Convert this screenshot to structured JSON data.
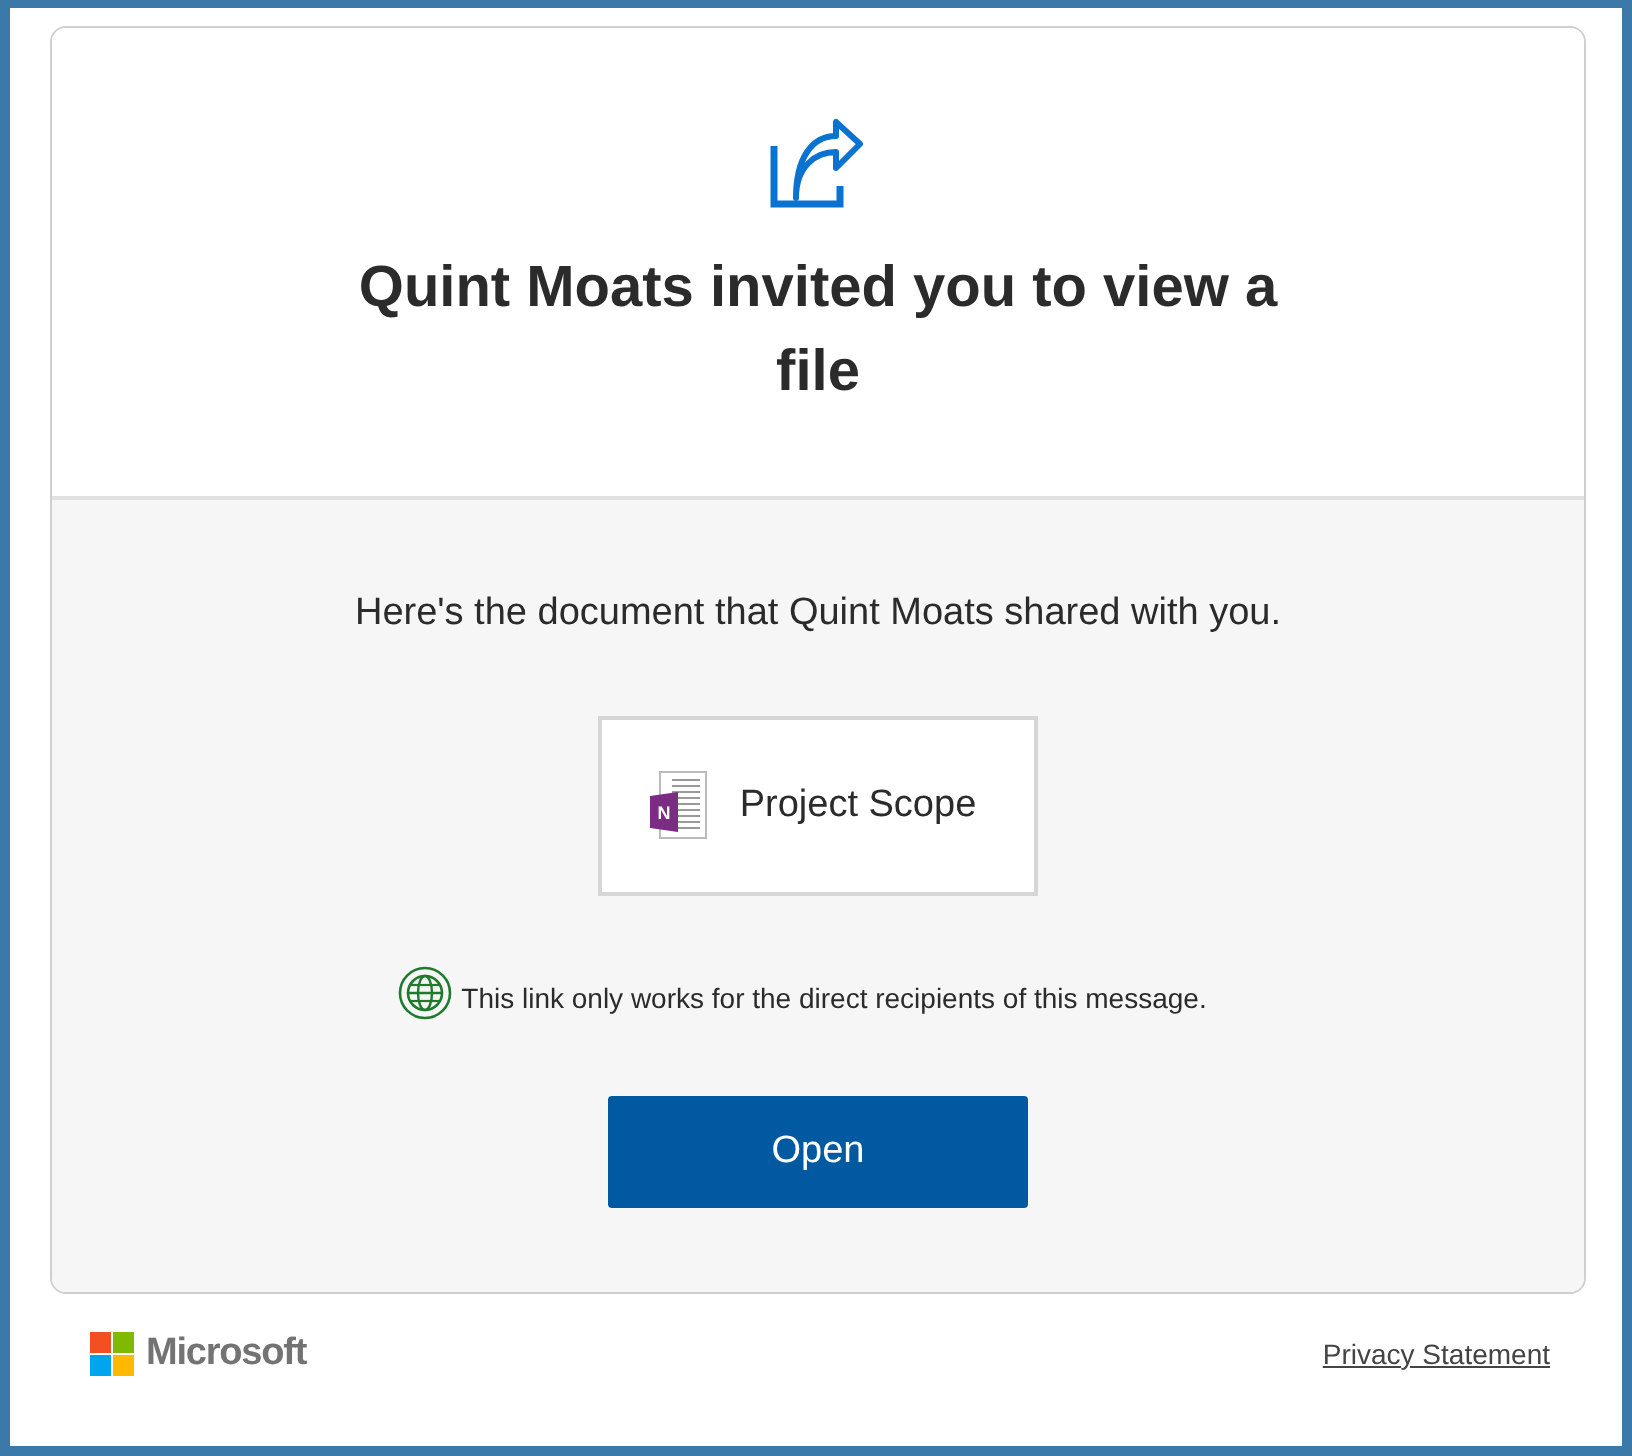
{
  "header": {
    "title": "Quint Moats invited you to view a file"
  },
  "body": {
    "message": "Here's the document that Quint Moats shared with you.",
    "file": {
      "name": "Project Scope",
      "app_letter": "N"
    },
    "notice": "This link only works for the direct recipients of this message.",
    "open_button": "Open"
  },
  "footer": {
    "brand": "Microsoft",
    "privacy_link": "Privacy Statement"
  }
}
